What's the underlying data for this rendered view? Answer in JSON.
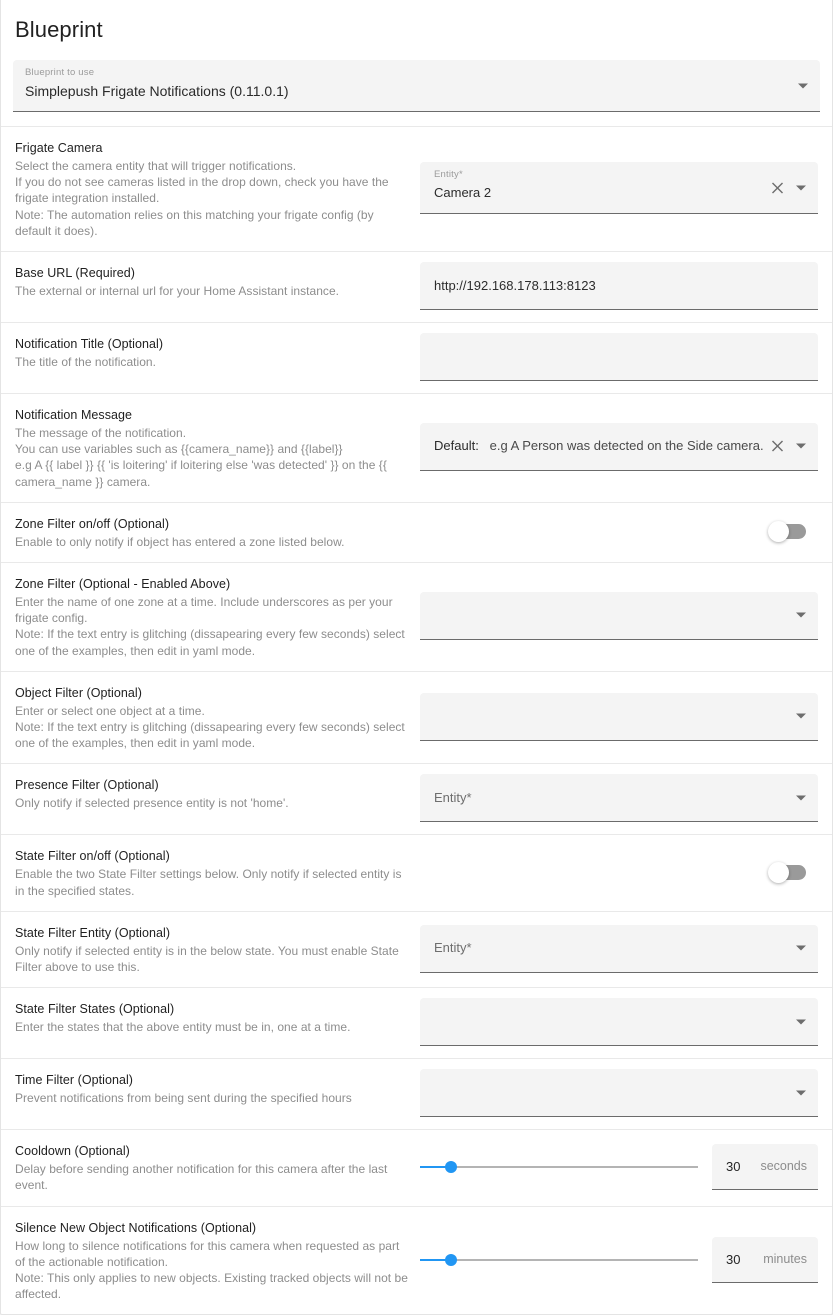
{
  "header": {
    "title": "Blueprint",
    "blueprint_select": {
      "label": "Blueprint to use",
      "value": "Simplepush Frigate Notifications (0.11.0.1)"
    }
  },
  "rows": [
    {
      "title": "Frigate Camera",
      "desc": "Select the camera entity that will trigger notifications.\nIf you do not see cameras listed in the drop down, check you have the frigate integration installed.\nNote: The automation relies on this matching your frigate config (by default it does).",
      "control": "entity_filled",
      "float_label": "Entity*",
      "value": "Camera 2"
    },
    {
      "title": "Base URL (Required)",
      "desc": "The external or internal url for your Home Assistant instance.",
      "control": "text",
      "value": "http://192.168.178.113:8123"
    },
    {
      "title": "Notification Title (Optional)",
      "desc": "The title of the notification.",
      "control": "text",
      "value": ""
    },
    {
      "title": "Notification Message",
      "desc": "The message of the notification.\nYou can use variables such as {{camera_name}} and {{label}}\ne.g A {{ label }} {{ 'is loitering' if loitering else 'was detected' }} on the {{ camera_name }} camera.",
      "control": "default_combo",
      "prefix": "Default:",
      "value": "e.g A Person was detected on the Side camera."
    },
    {
      "title": "Zone Filter on/off (Optional)",
      "desc": "Enable to only notify if object has entered a zone listed below.",
      "control": "toggle",
      "value": "off"
    },
    {
      "title": "Zone Filter (Optional - Enabled Above)",
      "desc": "Enter the name of one zone at a time. Include underscores as per your frigate config.\nNote: If the text entry is glitching (dissapearing every few seconds) select one of the examples, then edit in yaml mode.",
      "control": "select",
      "value": ""
    },
    {
      "title": "Object Filter (Optional)",
      "desc": "Enter or select one object at a time.\nNote: If the text entry is glitching (dissapearing every few seconds) select one of the examples, then edit in yaml mode.",
      "control": "select",
      "value": ""
    },
    {
      "title": "Presence Filter (Optional)",
      "desc": "Only notify if selected presence entity is not 'home'.",
      "control": "select",
      "value": "Entity*"
    },
    {
      "title": "State Filter on/off (Optional)",
      "desc": "Enable the two State Filter settings below. Only notify if selected entity is in the specified states.",
      "control": "toggle",
      "value": "off"
    },
    {
      "title": "State Filter Entity (Optional)",
      "desc": "Only notify if selected entity is in the below state. You must enable State Filter above to use this.",
      "control": "select",
      "value": "Entity*"
    },
    {
      "title": "State Filter States (Optional)",
      "desc": "Enter the states that the above entity must be in, one at a time.",
      "control": "select",
      "value": ""
    },
    {
      "title": "Time Filter (Optional)",
      "desc": "Prevent notifications from being sent during the specified hours",
      "control": "select",
      "value": ""
    },
    {
      "title": "Cooldown (Optional)",
      "desc": "Delay before sending another notification for this camera after the last event.",
      "control": "slider",
      "value": "30",
      "unit": "seconds",
      "percent": 11
    },
    {
      "title": "Silence New Object Notifications (Optional)",
      "desc": "How long to silence notifications for this camera when requested as part of the actionable notification.\nNote: This only applies to new objects. Existing tracked objects will not be affected.",
      "control": "slider",
      "value": "30",
      "unit": "minutes",
      "percent": 11
    }
  ],
  "colors": {
    "accent": "#2196f3",
    "field_bg": "#f4f4f4",
    "text": "#1f1f1f",
    "muted": "#8d8d8d"
  }
}
